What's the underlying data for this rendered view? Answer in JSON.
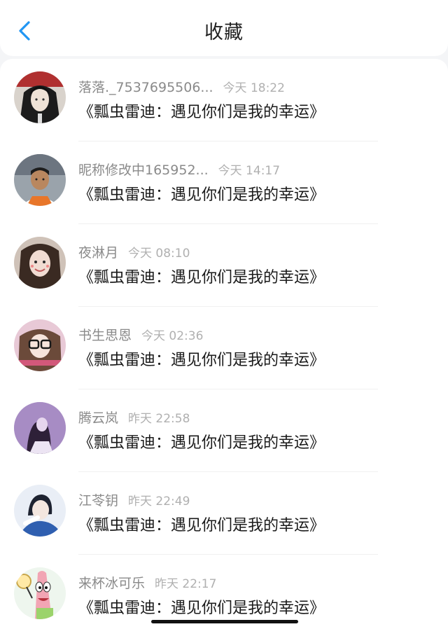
{
  "header": {
    "back_icon": "chevron-left-icon",
    "title": "收藏",
    "accent_color": "#2196f3"
  },
  "items": [
    {
      "name": "落落._7537695506...",
      "time": "今天 18:22",
      "content": "《瓢虫雷迪：遇见你们是我的幸运》",
      "avatar_icon": "avatar-anime-character"
    },
    {
      "name": "昵称修改中165952...",
      "time": "今天 14:17",
      "content": "《瓢虫雷迪：遇见你们是我的幸运》",
      "avatar_icon": "avatar-boy-photo"
    },
    {
      "name": "夜淋月",
      "time": "今天 08:10",
      "content": "《瓢虫雷迪：遇见你们是我的幸运》",
      "avatar_icon": "avatar-girl-photo"
    },
    {
      "name": "书生思恩",
      "time": "今天 02:36",
      "content": "《瓢虫雷迪：遇见你们是我的幸运》",
      "avatar_icon": "avatar-glasses-girl"
    },
    {
      "name": "腾云岚",
      "time": "昨天 22:58",
      "content": "《瓢虫雷迪：遇见你们是我的幸运》",
      "avatar_icon": "avatar-purple-figure"
    },
    {
      "name": "江苓钥",
      "time": "昨天 22:49",
      "content": "《瓢虫雷迪：遇见你们是我的幸运》",
      "avatar_icon": "avatar-blue-figure"
    },
    {
      "name": "来杯冰可乐",
      "time": "昨天 22:17",
      "content": "《瓢虫雷迪：遇见你们是我的幸运》",
      "avatar_icon": "avatar-patrick-cartoon"
    }
  ]
}
